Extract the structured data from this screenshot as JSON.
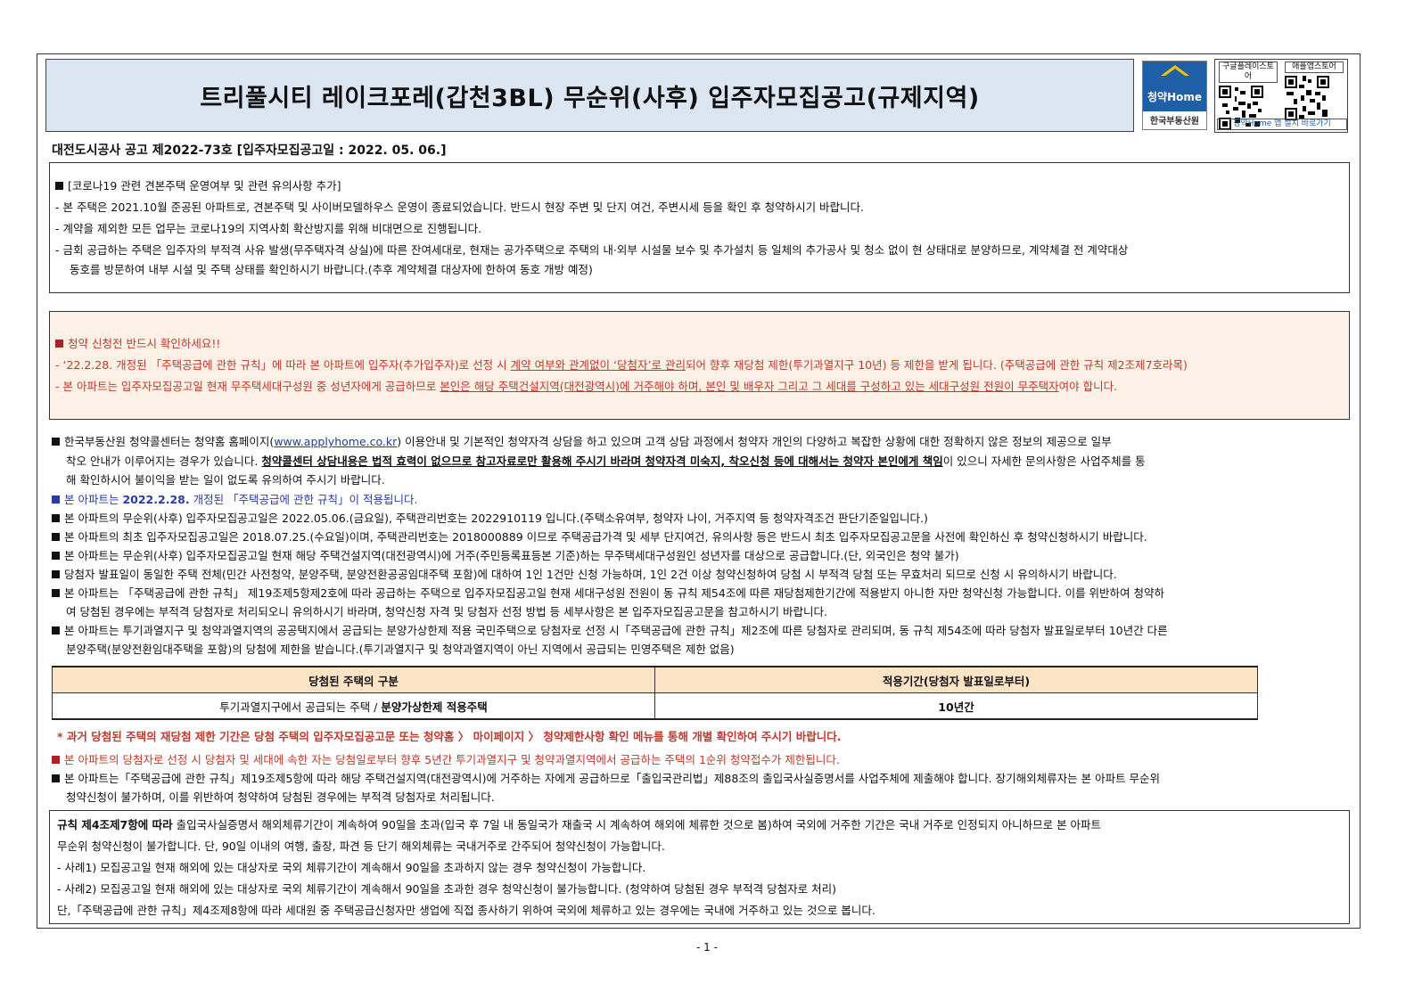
{
  "title": "트리풀시티 레이크포레(갑천3BL) 무순위(사후) 입주자모집공고(규제지역)",
  "logo": {
    "brand": "청약Home",
    "org": "한국부동산원"
  },
  "qr": {
    "google_label": "구글플레이스토어",
    "apple_label": "애플앱스토어",
    "footer": "청약Home 앱 설치 바로가기"
  },
  "notice_no": "대전도시공사 공고 제2022-73호 [입주자모집공고일 : 2022. 05. 06.]",
  "box1": [
    "[코로나19 관련 견본주택 운영여부 및 관련 유의사항 추가]",
    "- 본 주택은 2021.10월 준공된 아파트로, 견본주택 및 사이버모델하우스 운영이 종료되었습니다. 반드시 현장 주변 및 단지 여건, 주변시세 등을 확인 후 청약하시기 바랍니다.",
    "- 계약을 제외한 모든 업무는 코로나19의 지역사회 확산방지를 위해 비대면으로 진행됩니다.",
    "- 금회 공급하는 주택은 입주자의 부적격 사유 발생(무주택자격 상실)에 따른 잔여세대로, 현재는 공가주택으로 주택의 내·외부 시설물 보수 및 추가설치 등 일체의 추가공사 및 청소 없이 현 상태대로 분양하므로, 계약체결 전 계약대상",
    "동호를 방문하여 내부 시설 및 주택 상태를 확인하시기 바랍니다.(추후 계약체결 대상자에 한하여 동호 개방 예정)"
  ],
  "box2": {
    "heading": "청약 신청전 반드시 확인하세요!!",
    "l1a": "- ‘22.2.28. 개정된 「주택공급에 관한 규칙」에 따라 본 아파트에 입주자(추가입주자)로 선정 시 ",
    "l1b": "계약 여부와 관계없이 ‘당첨자’로 관리",
    "l1c": "되어 향후 재당첨 제한(투기과열지구 10년) 등 제한을 받게 됩니다. (주택공급에 관한 규칙 제2조제7호라목)",
    "l2a": "- 본 아파트는 입주자모집공고일 현재 무주택세대구성원 중 성년자에게 공급하므로 ",
    "l2b": "본인은 해당 주택건설지역(대전광역시)에 거주해야 하며, 본인 및 배우자 그리고 그 세대를 구성하고 있는 세대구성원 전원이 무주택자",
    "l2c": "여야 합니다."
  },
  "main": {
    "p1a": "한국부동산원 청약콜센터는 청약홈 홈페이지(",
    "p1link": "www.applyhome.co.kr",
    "p1b": ") 이용안내 및 기본적인 청약자격 상담을 하고 있으며 고객 상담 과정에서 청약자 개인의 다양하고 복잡한 상황에 대한 정확하지 않은 정보의 제공으로 일부",
    "p1c": "착오 안내가 이루어지는 경우가 있습니다. ",
    "p1d": "청약콜센터 상담내용은 법적 효력이 없으므로 참고자료로만 활용해 주시기 바라며 청약자격 미숙지, 착오신청 등에 대해서는 청약자 본인에게 책임",
    "p1e": "이 있으니 자세한 문의사항은 사업주체를 통",
    "p1f": "해 확인하시어 불이익을 받는 일이 없도록 유의하여 주시기 바랍니다.",
    "p2a": "본 아파트는 ",
    "p2b": "2022.2.28.",
    "p2c": " 개정된 「주택공급에 관한 규칙」이 적용됩니다.",
    "p3": "본 아파트의 무순위(사후) 입주자모집공고일은 2022.05.06.(금요일), 주택관리번호는 2022910119 입니다.(주택소유여부, 청약자 나이, 거주지역 등 청약자격조건 판단기준일입니다.)",
    "p4": "본 아파트의 최초 입주자모집공고일은 2018.07.25.(수요일)이며, 주택관리번호는 2018000889 이므로 주택공급가격 및 세부 단지여건, 유의사항 등은 반드시 최초 입주자모집공고문을 사전에 확인하신 후 청약신청하시기 바랍니다.",
    "p5": "본 아파트는 무순위(사후) 입주자모집공고일 현재 해당 주택건설지역(대전광역시)에 거주(주민등록표등본 기준)하는 무주택세대구성원인 성년자를 대상으로 공급합니다.(단, 외국인은 청약 불가)",
    "p6": "당첨자 발표일이 동일한 주택 전체(민간 사전청약, 분양주택, 분양전환공공임대주택 포함)에 대하여 1인 1건만 신청 가능하며, 1인 2건 이상 청약신청하여 당첨 시 부적격 당첨 또는 무효처리 되므로 신청 시 유의하시기 바랍니다.",
    "p7a": "본 아파트는 「주택공급에 관한 규칙」 제19조제5항제2호에 따라 공급하는 주택으로 입주자모집공고일 현재 세대구성원 전원이 동 규칙 제54조에 따른 재당첨제한기간에 적용받지 아니한 자만 청약신청 가능합니다. 이를 위반하여 청약하",
    "p7b": "여 당첨된 경우에는 부적격 당첨자로 처리되오니 유의하시기 바라며, 청약신청 자격 및 당첨자 선정 방법 등 세부사항은 본 입주자모집공고문을 참고하시기 바랍니다.",
    "p8a": "본 아파트는 투기과열지구 및 청약과열지역의 공공택지에서 공급되는 분양가상한제 적용 국민주택으로 당첨자로 선정 시「주택공급에 관한 규칙」제2조에 따른 당첨자로 관리되며, 동 규칙 제54조에 따라 당첨자 발표일로부터 10년간 다른",
    "p8b": "분양주택(분양전환임대주택을 포함)의 당첨에 제한을 받습니다.(투기과열지구 및 청약과열지역이 아닌 지역에서 공급되는 민영주택은 제한 없음)"
  },
  "table": {
    "headers": [
      "당첨된 주택의 구분",
      "적용기간(당첨자 발표일로부터)"
    ],
    "row_a": "투기과열지구에서 공급되는 주택 / ",
    "row_b": "분양가상한제 적용주택",
    "row_period": "10년간"
  },
  "note_red": "* 과거 당첨된 주택의 재당첨 제한 기간은 당첨 주택의 입주자모집공고문 또는 청약홈 〉 마이페이지 〉 청약제한사항 확인 메뉴를 통해 개별 확인하여 주시기 바랍니다.",
  "p9": "본 아파트의 당첨자로 선정 시 당첨자 및 세대에 속한 자는 당첨일로부터 향후 5년간 투기과열지구 및 청약과열지역에서 공급하는 주택의 1순위 청약접수가 제한됩니다.",
  "p10a": "본 아파트는「주택공급에 관한 규칙」제19조제5항에 따라 해당 주택건설지역(대전광역시)에 거주하는 자에게 공급하므로「출입국관리법」제88조의 출입국사실증명서를 사업주체에 제출해야 합니다. 장기해외체류자는 본 아파트 무순위",
  "p10b": "청약신청이 불가하며, 이를 위반하여 청약하여 당첨된 경우에는 부적격 당첨자로 처리됩니다.",
  "box3": {
    "l1a": "규칙 제4조제7항에 따라",
    "l1b": " 출입국사실증명서 해외체류기간이 계속하여 90일을 초과(입국 후 7일 내 동일국가 재출국 시 계속하여 해외에 체류한 것으로 봄)하여 국외에 거주한 기간은 국내 거주로 인정되지 아니하므로 본 아파트",
    "l2": "무순위 청약신청이 불가합니다. 단, 90일 이내의 여행, 출장, 파견 등 단기 해외체류는 국내거주로 간주되어 청약신청이 가능합니다.",
    "l3": "- 사례1) 모집공고일 현재 해외에 있는 대상자로 국외 체류기간이 계속해서 90일을 초과하지 않는 경우 청약신청이 가능합니다.",
    "l4": "- 사례2) 모집공고일 현재 해외에 있는 대상자로 국외 체류기간이 계속해서 90일을 초과한 경우 청약신청이 불가능합니다. (청약하여 당첨된 경우 부적격 당첨자로 처리)",
    "l5": "단,「주택공급에 관한 규칙」제4조제8항에 따라 세대원 중 주택공급신청자만 생업에 직접 종사하기 위하여 국외에 체류하고 있는 경우에는 국내에 거주하고 있는 것으로 봅니다."
  },
  "page_number": "- 1 -",
  "colors": {
    "title_bg": "#dce6f2",
    "warn_bg": "#fdf0e6",
    "red": "#c0392b",
    "blue": "#2a3aa8",
    "table_head": "#fbe3c6",
    "brand": "#1f5fa8"
  }
}
